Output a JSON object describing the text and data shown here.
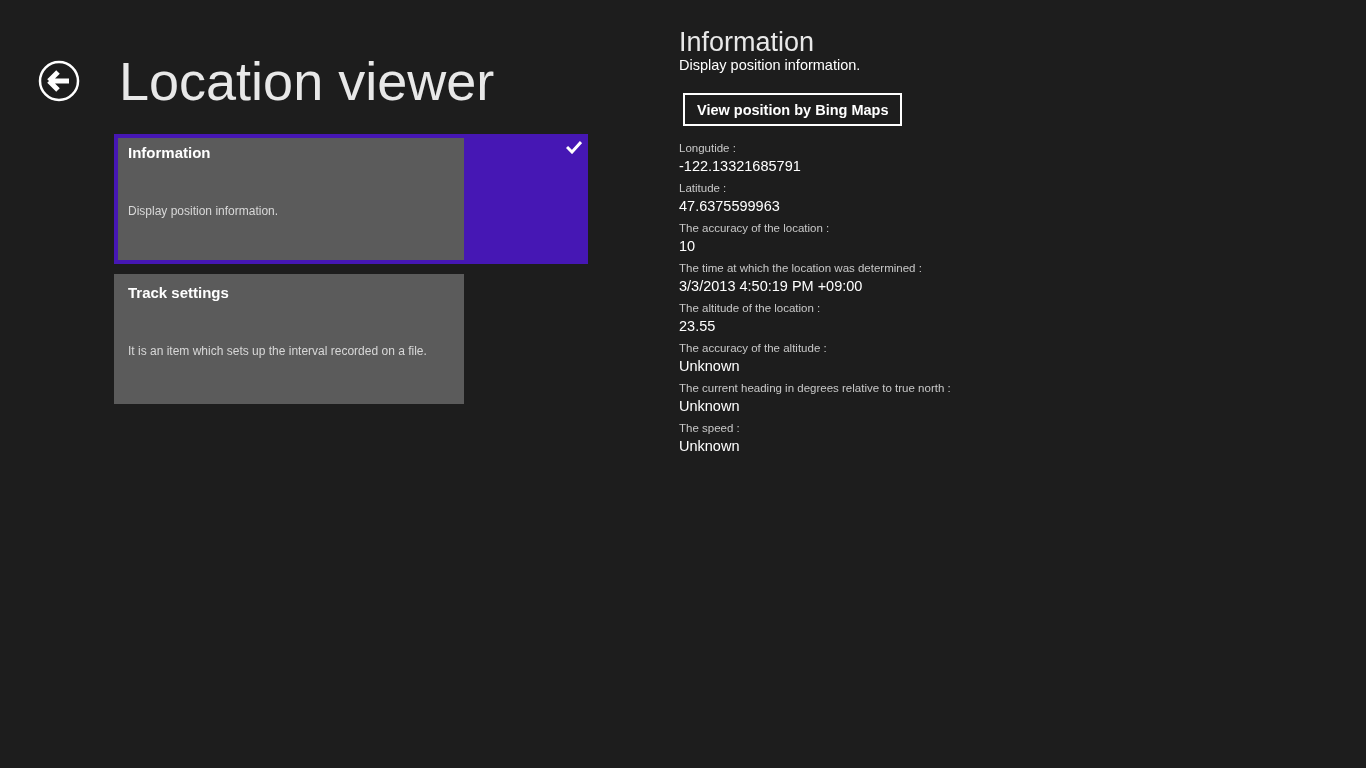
{
  "header": {
    "title": "Location viewer"
  },
  "items": [
    {
      "title": "Information",
      "description": "Display position information.",
      "selected": true
    },
    {
      "title": "Track settings",
      "description": "It is an item which sets up the interval recorded on a file.",
      "selected": false
    }
  ],
  "detail": {
    "title": "Information",
    "subtitle": "Display position information.",
    "button": "View position by Bing Maps",
    "fields": [
      {
        "label": "Longutide :",
        "value": "-122.13321685791"
      },
      {
        "label": "Latitude :",
        "value": "47.6375599963"
      },
      {
        "label": "The accuracy of the location :",
        "value": "10"
      },
      {
        "label": "The time at which the location was determined :",
        "value": "3/3/2013 4:50:19 PM +09:00"
      },
      {
        "label": "The altitude of the location :",
        "value": "23.55"
      },
      {
        "label": "The accuracy of the altitude :",
        "value": "Unknown"
      },
      {
        "label": "The current heading in degrees relative to true north :",
        "value": "Unknown"
      },
      {
        "label": "The speed :",
        "value": "Unknown"
      }
    ]
  }
}
